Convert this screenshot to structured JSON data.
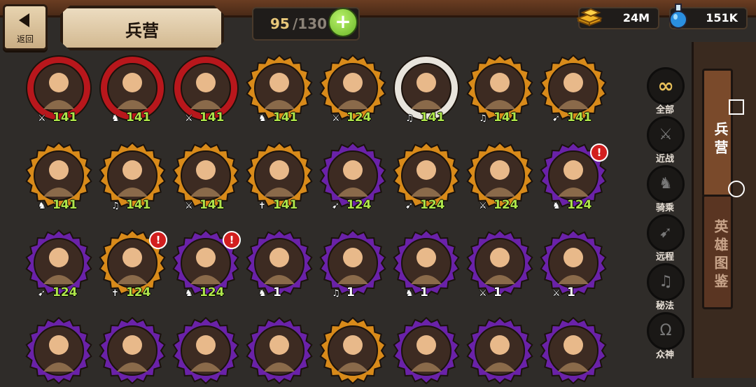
{
  "header": {
    "back_label": "返回",
    "title": "兵营",
    "unit_count": "95",
    "unit_max": "/130",
    "add_label": "+"
  },
  "resources": {
    "gold": "24M",
    "potion": "151K"
  },
  "filters": [
    {
      "label": "全部",
      "icon": "infinity-icon",
      "glyph": "∞",
      "active": true
    },
    {
      "label": "近战",
      "icon": "sword-icon",
      "glyph": "⚔",
      "active": false
    },
    {
      "label": "骑乘",
      "icon": "horse-icon",
      "glyph": "♞",
      "active": false
    },
    {
      "label": "远程",
      "icon": "bow-icon",
      "glyph": "➹",
      "active": false
    },
    {
      "label": "秘法",
      "icon": "magic-icon",
      "glyph": "♫",
      "active": false
    },
    {
      "label": "众神",
      "icon": "omega-icon",
      "glyph": "Ω",
      "active": false
    }
  ],
  "side_tabs": [
    {
      "label": "兵营",
      "active": true
    },
    {
      "label": "英雄图鉴",
      "active": false
    }
  ],
  "units": [
    {
      "level": "141",
      "class": "melee",
      "border": "red",
      "alert": false
    },
    {
      "level": "141",
      "class": "mounted",
      "border": "red",
      "alert": false
    },
    {
      "level": "141",
      "class": "melee",
      "border": "red",
      "alert": false
    },
    {
      "level": "141",
      "class": "mounted",
      "border": "gold",
      "alert": false
    },
    {
      "level": "124",
      "class": "melee",
      "border": "gold",
      "alert": false
    },
    {
      "level": "141",
      "class": "magic",
      "border": "white",
      "alert": false
    },
    {
      "level": "141",
      "class": "magic",
      "border": "gold",
      "alert": false
    },
    {
      "level": "141",
      "class": "ranged",
      "border": "gold",
      "alert": false
    },
    {
      "level": "141",
      "class": "mounted",
      "border": "gold",
      "alert": false
    },
    {
      "level": "141",
      "class": "magic",
      "border": "gold",
      "alert": false
    },
    {
      "level": "141",
      "class": "melee",
      "border": "gold",
      "alert": false
    },
    {
      "level": "141",
      "class": "holy",
      "border": "gold",
      "alert": false
    },
    {
      "level": "124",
      "class": "ranged",
      "border": "purple",
      "alert": false
    },
    {
      "level": "124",
      "class": "ranged",
      "border": "gold",
      "alert": false
    },
    {
      "level": "124",
      "class": "melee",
      "border": "gold",
      "alert": false
    },
    {
      "level": "124",
      "class": "mounted",
      "border": "purple",
      "alert": true
    },
    {
      "level": "124",
      "class": "ranged",
      "border": "purple",
      "alert": false
    },
    {
      "level": "124",
      "class": "holy",
      "border": "gold",
      "alert": true
    },
    {
      "level": "124",
      "class": "mounted",
      "border": "purple",
      "alert": true
    },
    {
      "level": "1",
      "class": "mounted",
      "border": "purple",
      "alert": false
    },
    {
      "level": "1",
      "class": "magic",
      "border": "purple",
      "alert": false
    },
    {
      "level": "1",
      "class": "mounted",
      "border": "purple",
      "alert": false
    },
    {
      "level": "1",
      "class": "melee",
      "border": "purple",
      "alert": false
    },
    {
      "level": "1",
      "class": "melee",
      "border": "purple",
      "alert": false
    },
    {
      "level": "",
      "class": "",
      "border": "purple",
      "alert": false
    },
    {
      "level": "",
      "class": "",
      "border": "purple",
      "alert": false
    },
    {
      "level": "",
      "class": "",
      "border": "purple",
      "alert": false
    },
    {
      "level": "",
      "class": "",
      "border": "purple",
      "alert": false
    },
    {
      "level": "",
      "class": "",
      "border": "gold",
      "alert": false
    },
    {
      "level": "",
      "class": "",
      "border": "purple",
      "alert": false
    },
    {
      "level": "",
      "class": "",
      "border": "purple",
      "alert": false
    },
    {
      "level": "",
      "class": "",
      "border": "purple",
      "alert": false
    }
  ],
  "colors": {
    "red": "#b8171c",
    "gold": "#d88a1a",
    "purple": "#6a22a8",
    "white": "#e8e4dc",
    "level_green": "#aee54b",
    "accent_green": "#6ab526"
  }
}
